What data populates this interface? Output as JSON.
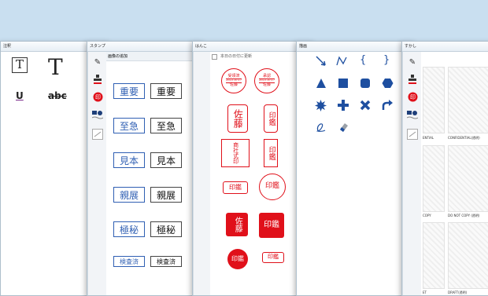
{
  "windows": {
    "text": {
      "title": "注釈",
      "text_tool": "T",
      "underline": "U",
      "strike": "abc"
    },
    "stamp": {
      "title": "スタンプ",
      "add_image": "画像の追加",
      "stamps": [
        [
          "重要",
          "重要"
        ],
        [
          "至急",
          "至急"
        ],
        [
          "見本",
          "見本"
        ],
        [
          "親展",
          "親展"
        ],
        [
          "極秘",
          "極秘"
        ],
        [
          "検査済",
          "検査済"
        ]
      ]
    },
    "hanko": {
      "title": "はんこ",
      "date_update_label": "本日の日付に更新",
      "date_stamp_1": {
        "top": "受領済",
        "date": "2023.10.17",
        "name": "佐藤"
      },
      "date_stamp_2": {
        "top": "承認",
        "date": "2023.10.17",
        "name": "佐藤"
      },
      "sato": "佐藤",
      "inkan": "印鑑",
      "company": "商事株式会社印",
      "company2": "商社式印"
    },
    "draw": {
      "title": "描画",
      "brace_open": "{",
      "brace_close": "}"
    },
    "watermark": {
      "title": "すかし",
      "labels": [
        "ENTIAL",
        "CONFIDENTIAL(透明)",
        "COPY",
        "DO NOT COPY (透明)",
        "ET",
        "DRAFT(透明)"
      ]
    }
  },
  "colors": {
    "hanko_red": "#e0101a",
    "stamp_blue": "#2f5fb3",
    "bg": "#c9dff0"
  },
  "icons": [
    "pen-icon",
    "seal-stamp-icon",
    "hanko-icon",
    "shapes-icon",
    "watermark-icon"
  ]
}
